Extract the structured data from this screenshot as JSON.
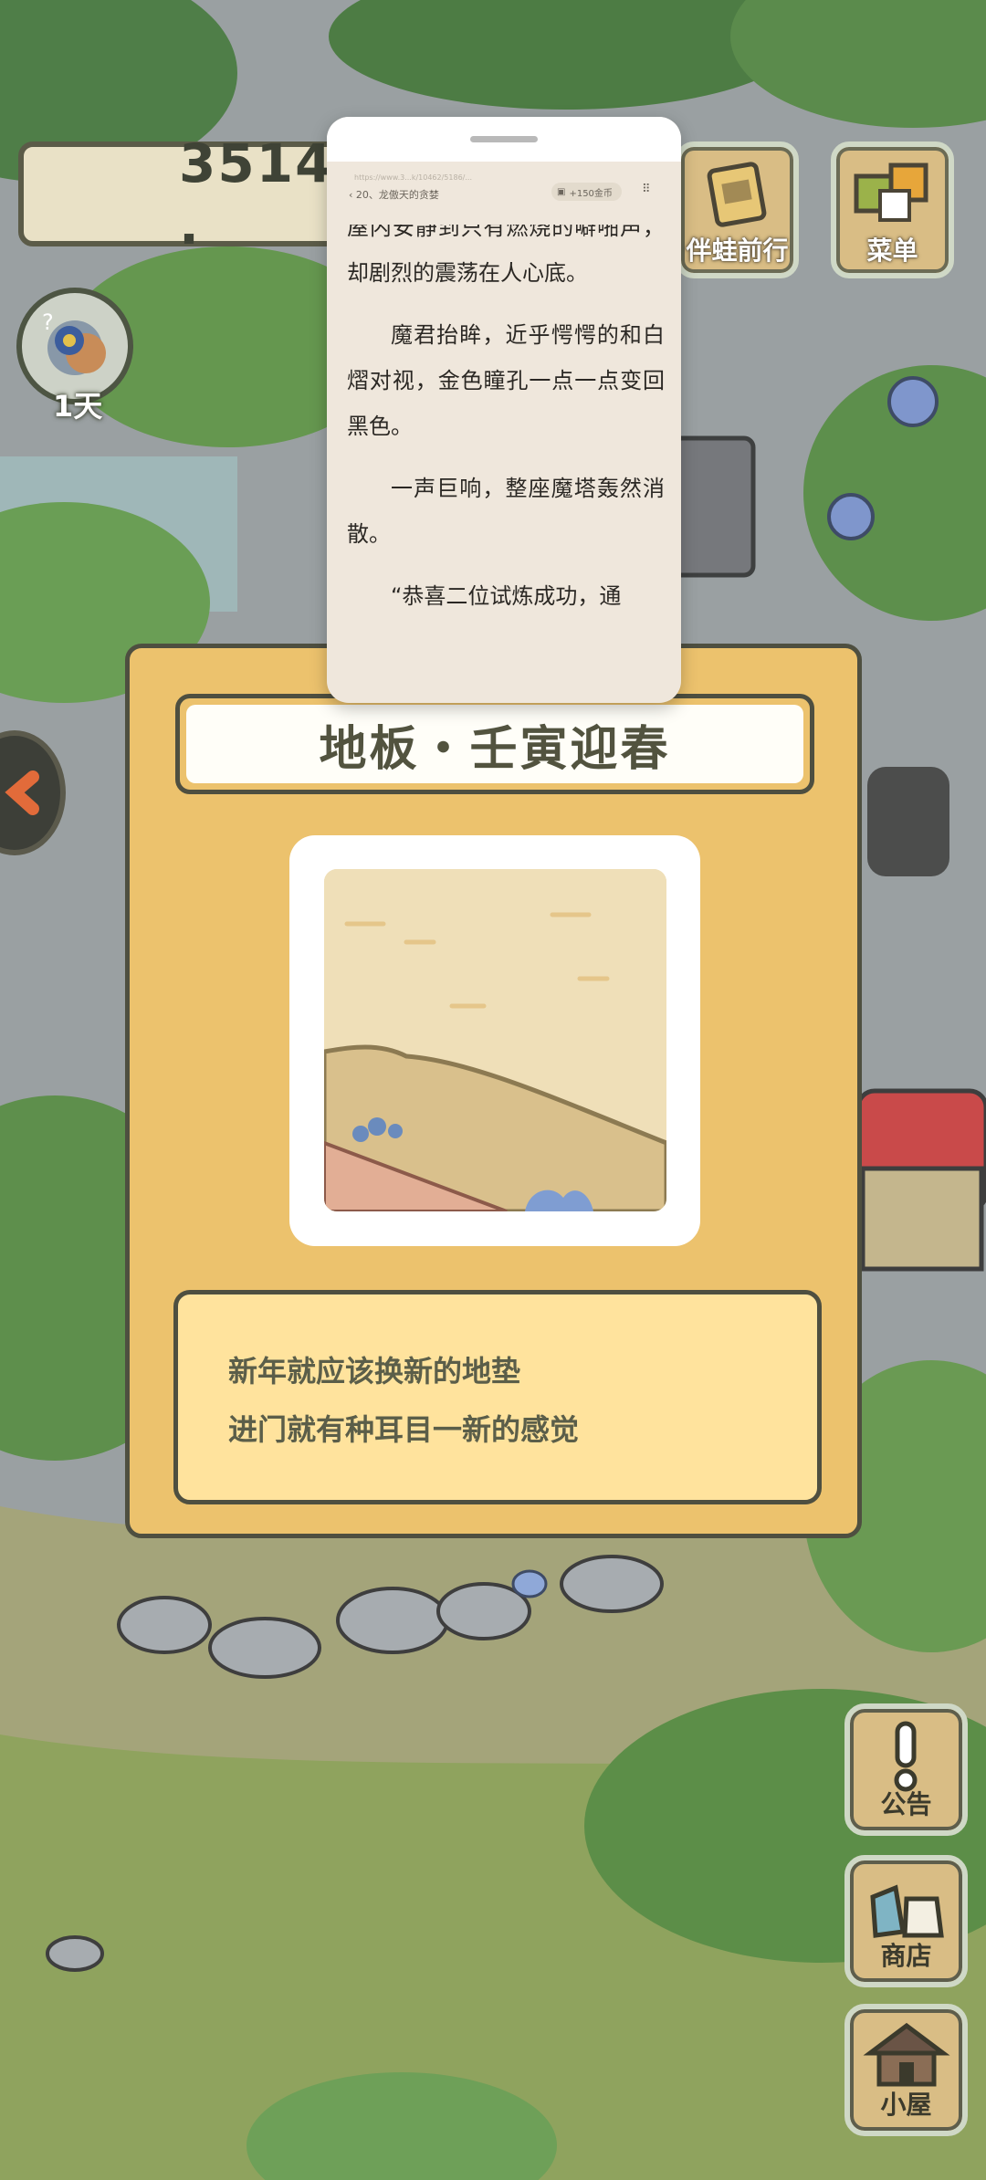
{
  "score": {
    "value": "3514 ."
  },
  "day_badge": {
    "label": "1天"
  },
  "top_buttons": [
    {
      "label": "伴蛙前行",
      "icon": "book-icon"
    },
    {
      "label": "菜单",
      "icon": "menu-icon"
    }
  ],
  "side_buttons": [
    {
      "label": "公告",
      "icon": "exclamation-icon"
    },
    {
      "label": "商店",
      "icon": "bag-icon"
    },
    {
      "label": "小屋",
      "icon": "house-icon"
    }
  ],
  "item_card": {
    "title": "地板・壬寅迎春",
    "description": [
      "新年就应该换新的地垫",
      "进门就有种耳目一新的感觉"
    ]
  },
  "reader": {
    "url": "https://www.3...k/10462/5186/...",
    "chapter": "‹ 20、龙傲天的贪婪",
    "coin_label": "+150金币",
    "more_icon": "grid-dots-icon",
    "paragraphs": [
      "屋内安静到只有燃烧的噼啪声，却剧烈的震荡在人心底。",
      "魔君抬眸，近乎愕愕的和白熠对视，金色瞳孔一点一点变回黑色。",
      "一声巨响，整座魔塔轰然消散。",
      "“恭喜二位试炼成功，通"
    ]
  },
  "colors": {
    "card": "#ecc26d",
    "card_border": "#4e4f40",
    "desc_bg": "#ffe39d",
    "reader_bg": "#efe7dc"
  }
}
